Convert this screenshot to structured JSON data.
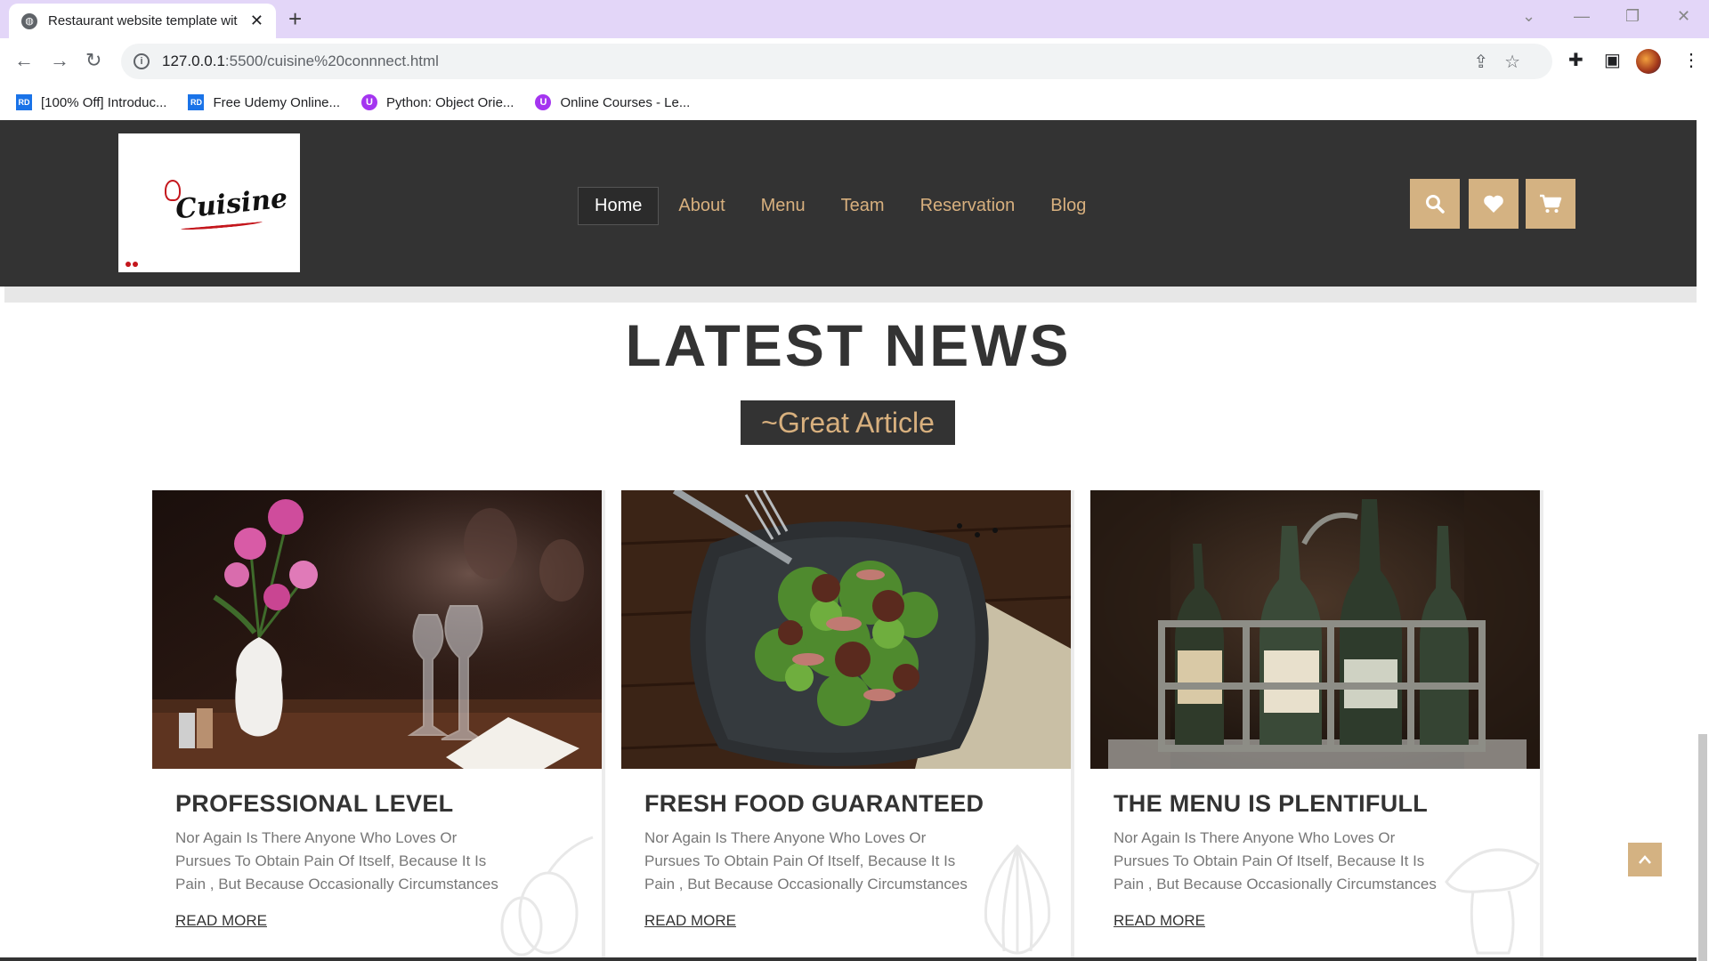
{
  "browser": {
    "tab_title": "Restaurant website template wit",
    "tab_icon": "globe-icon",
    "url_host": "127.0.0.1",
    "url_rest": ":5500/cuisine%20connnect.html",
    "bookmarks": [
      {
        "label": "[100% Off] Introduc...",
        "icon": "RD"
      },
      {
        "label": "Free Udemy Online...",
        "icon": "RD"
      },
      {
        "label": "Python: Object Orie...",
        "icon": "U"
      },
      {
        "label": "Online Courses - Le...",
        "icon": "U"
      }
    ]
  },
  "site": {
    "logo_text": "Cuisine",
    "nav": [
      "Home",
      "About",
      "Menu",
      "Team",
      "Reservation",
      "Blog"
    ],
    "active_nav": "Home",
    "header_buttons": [
      "search-icon",
      "heart-icon",
      "cart-icon"
    ],
    "accent_color": "#d4b282",
    "header_color": "#333333"
  },
  "section": {
    "title": "LATEST NEWS",
    "subtitle": "~Great Article"
  },
  "cards": [
    {
      "title": "PROFESSIONAL LEVEL",
      "text": "Nor Again Is There Anyone Who Loves Or Pursues To Obtain Pain Of Itself, Because It Is Pain , But Because Occasionally Circumstances Occur.",
      "link": "READ MORE",
      "image": "restaurant-table-flowers-glasses"
    },
    {
      "title": "FRESH FOOD GUARANTEED",
      "text": "Nor Again Is There Anyone Who Loves Or Pursues To Obtain Pain Of Itself, Because It Is Pain , But Because Occasionally Circumstances Occur.",
      "link": "READ MORE",
      "image": "salad-plate-with-fork"
    },
    {
      "title": "THE MENU IS PLENTIFULL",
      "text": "Nor Again Is There Anyone Who Loves Or Pursues To Obtain Pain Of Itself, Because It Is Pain , But Because Occasionally Circumstances Occur.",
      "link": "READ MORE",
      "image": "wine-bottles-in-rack"
    }
  ]
}
